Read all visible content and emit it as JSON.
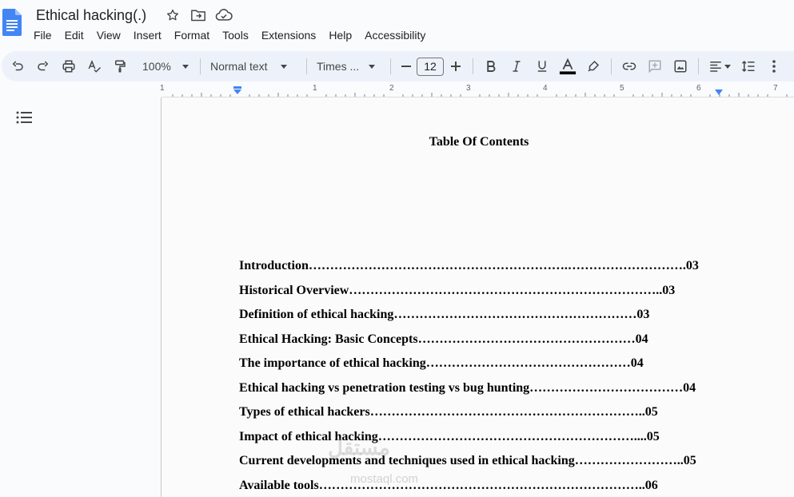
{
  "document": {
    "title": "Ethical hacking(.)"
  },
  "menu": [
    "File",
    "Edit",
    "View",
    "Insert",
    "Format",
    "Tools",
    "Extensions",
    "Help",
    "Accessibility"
  ],
  "toolbar": {
    "zoom": "100%",
    "style": "Normal text",
    "font": "Times ...",
    "font_size": "12"
  },
  "ruler": {
    "labels": [
      "1",
      "1",
      "2",
      "3",
      "4",
      "5",
      "6",
      "7"
    ]
  },
  "content": {
    "heading": "Table Of Contents",
    "toc": [
      "Introduction…………………………………………………….……………………….03",
      "Historical Overview………………………………………………………………..03",
      "Definition of ethical hacking…………………………………………………03",
      "Ethical Hacking: Basic Concepts……………………………………………04",
      "The importance of ethical hacking…………………………………………04",
      "Ethical hacking vs penetration testing vs bug hunting………………………………04",
      "Types of ethical hackers………………………………………………………..05",
      "Impact of ethical hacking……………………………………………………....05",
      "Current developments and techniques used in ethical hacking……………………..05",
      "Available tools…………………………………………………………………..06"
    ]
  },
  "watermark": {
    "main": "مستقل",
    "sub": "mostaql.com"
  },
  "colors": {
    "docs_blue": "#4285f4",
    "toolbar_bg": "#edf2fa",
    "ruler_marker": "#4285f4"
  }
}
